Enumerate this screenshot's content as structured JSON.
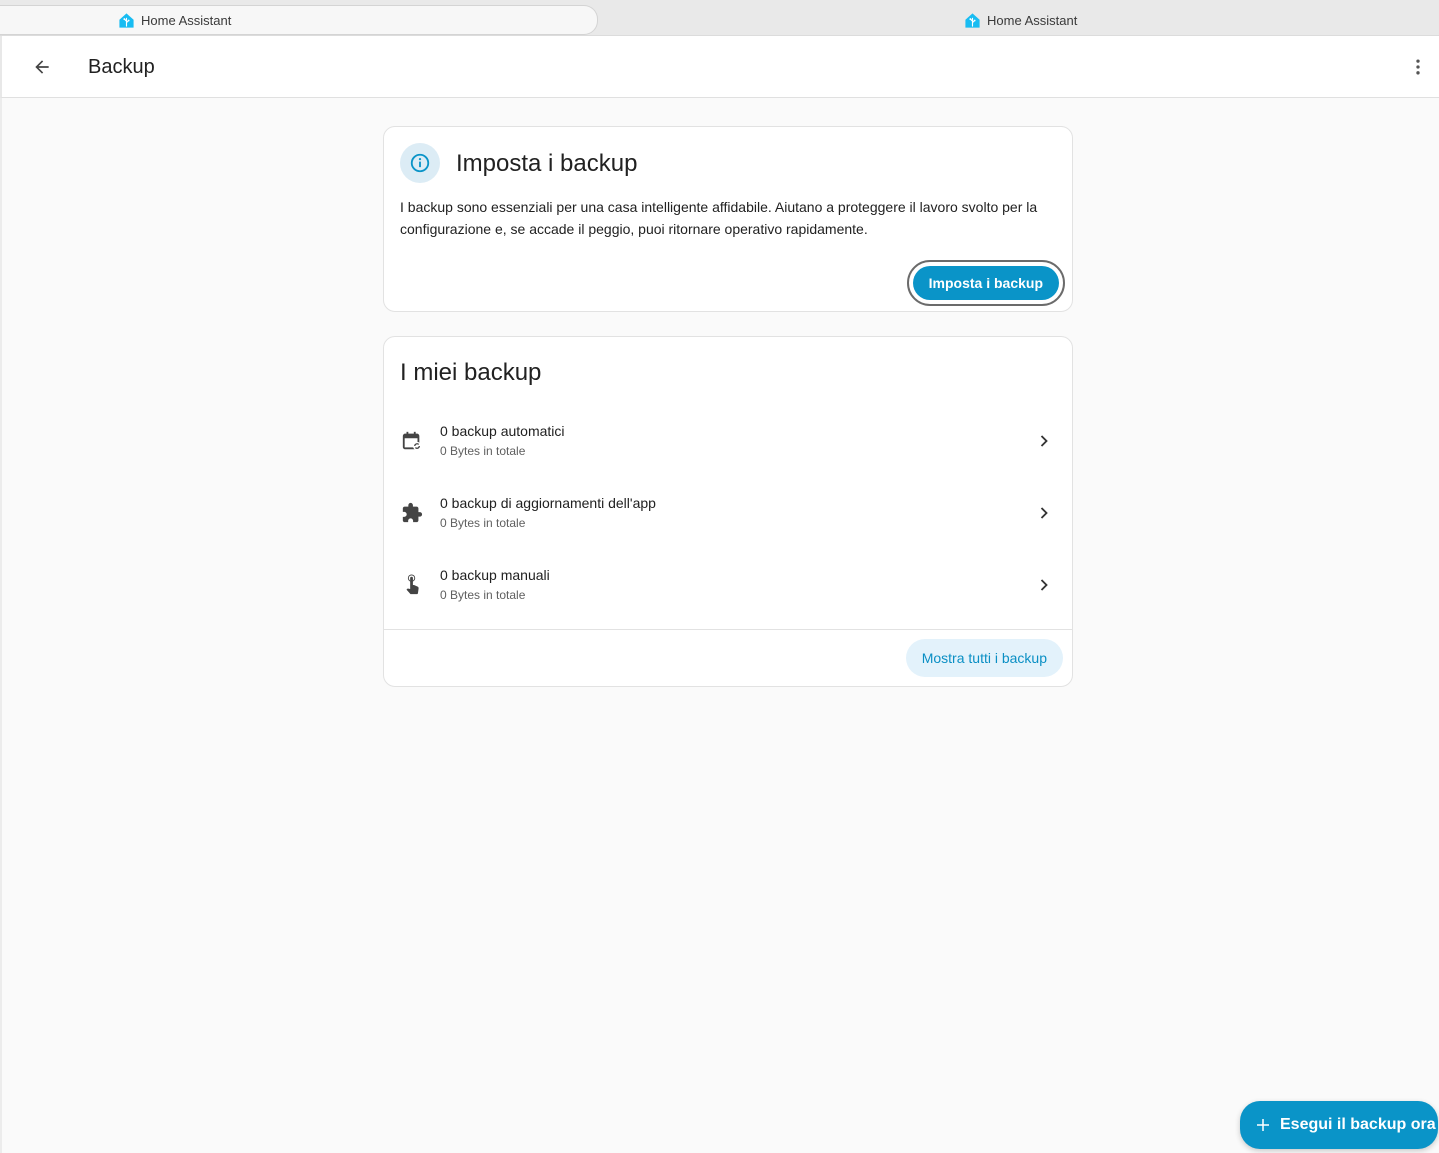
{
  "browser": {
    "tabs": [
      {
        "label": "Home Assistant",
        "active": true
      },
      {
        "label": "Home Assistant",
        "active": false
      }
    ]
  },
  "header": {
    "title": "Backup"
  },
  "setup_card": {
    "title": "Imposta i backup",
    "description": "I backup sono essenziali per una casa intelligente affidabile. Aiutano a proteggere il lavoro svolto per la configurazione e, se accade il peggio, puoi ritornare operativo rapidamente.",
    "button_label": "Imposta i backup"
  },
  "my_backups": {
    "title": "I miei backup",
    "items": [
      {
        "icon": "calendar-sync-icon",
        "title": "0 backup automatici",
        "subtitle": "0 Bytes in totale"
      },
      {
        "icon": "puzzle-icon",
        "title": "0 backup di aggiornamenti dell'app",
        "subtitle": "0 Bytes in totale"
      },
      {
        "icon": "gesture-tap-icon",
        "title": "0 backup manuali",
        "subtitle": "0 Bytes in totale"
      }
    ],
    "show_all_label": "Mostra tutti i backup"
  },
  "fab": {
    "label": "Esegui il backup ora"
  },
  "colors": {
    "primary": "#0a94c8",
    "tonal_bg": "#e3f2fb",
    "page_bg": "#fafafa"
  }
}
